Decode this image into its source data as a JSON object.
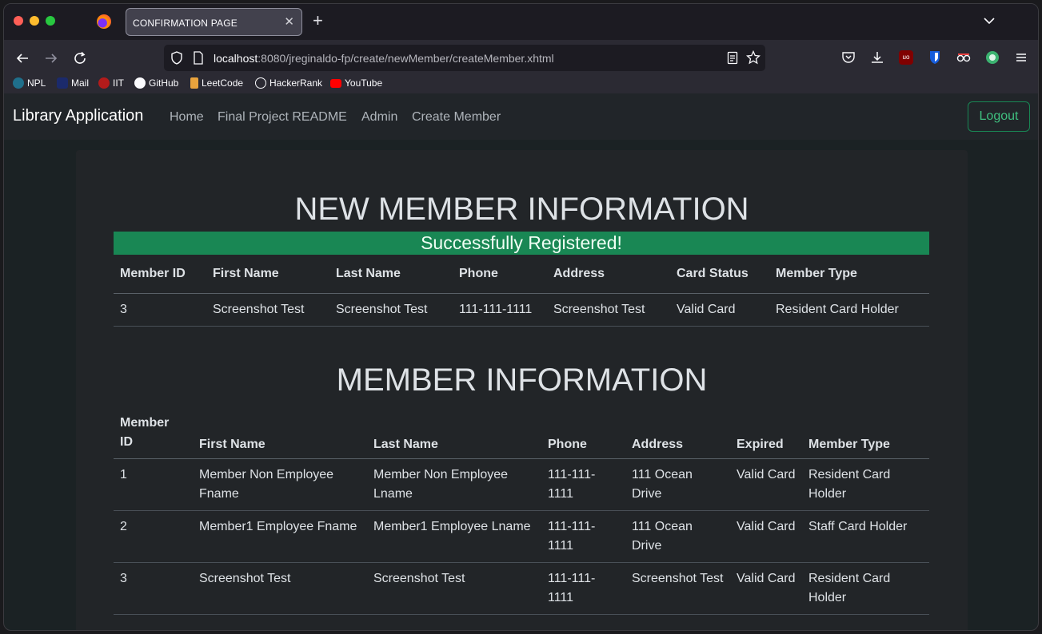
{
  "browser": {
    "tab_title": "CONFIRMATION PAGE",
    "url_host": "localhost",
    "url_rest": ":8080/jreginaldo-fp/create/newMember/createMember.xhtml",
    "bookmarks": [
      "NPL",
      "Mail",
      "IIT",
      "GitHub",
      "LeetCode",
      "HackerRank",
      "YouTube"
    ]
  },
  "navbar": {
    "brand": "Library Application",
    "links": [
      "Home",
      "Final Project README",
      "Admin",
      "Create Member"
    ],
    "logout": "Logout"
  },
  "new_member": {
    "heading": "NEW MEMBER INFORMATION",
    "success": "Successfully Registered!",
    "columns": [
      "Member ID",
      "First Name",
      "Last Name",
      "Phone",
      "Address",
      "Card Status",
      "Member Type"
    ],
    "row": [
      "3",
      "Screenshot Test",
      "Screenshot Test",
      "111-111-1111",
      "Screenshot Test",
      "Valid Card",
      "Resident Card Holder"
    ]
  },
  "members": {
    "heading": "MEMBER INFORMATION",
    "columns": [
      "Member ID",
      "First Name",
      "Last Name",
      "Phone",
      "Address",
      "Expired",
      "Member Type"
    ],
    "rows": [
      [
        "1",
        "Member Non Employee Fname",
        "Member Non Employee Lname",
        "111-111-1111",
        "111 Ocean Drive",
        "Valid Card",
        "Resident Card Holder"
      ],
      [
        "2",
        "Member1 Employee Fname",
        "Member1 Employee Lname",
        "111-111-1111",
        "111 Ocean Drive",
        "Valid Card",
        "Staff Card Holder"
      ],
      [
        "3",
        "Screenshot Test",
        "Screenshot Test",
        "111-111-1111",
        "Screenshot Test",
        "Valid Card",
        "Resident Card Holder"
      ]
    ]
  }
}
